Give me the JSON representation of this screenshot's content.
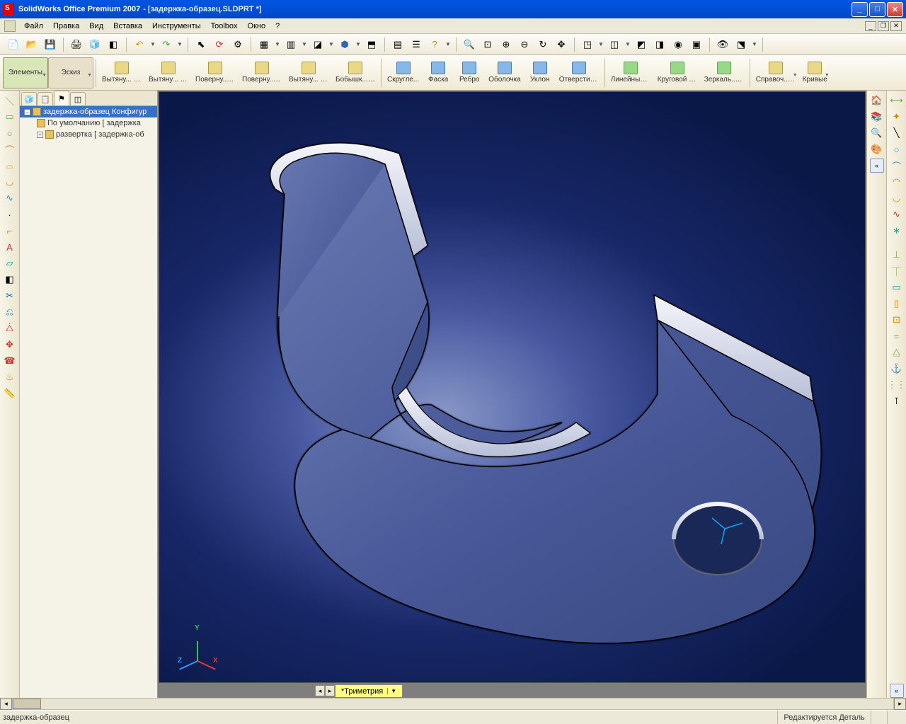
{
  "app": {
    "title": "SolidWorks Office Premium 2007",
    "doc": "- [задержка-образец.SLDPRT *]"
  },
  "menu": {
    "file": "Файл",
    "edit": "Правка",
    "view": "Вид",
    "insert": "Вставка",
    "tools": "Инструменты",
    "toolbox": "Toolbox",
    "window": "Окно",
    "help": "?"
  },
  "cmdBar": {
    "elements": "Элементы",
    "sketch": "Эскиз",
    "extrudeBoss": "Вытяну...\nбобышк...",
    "extrudeCut": "Вытяну...\nвырез",
    "revBoss": "Поверну...\nбобышк...",
    "revCut": "Поверну...\nвырез",
    "sweepBoss": "Вытяну...\nбобышк...",
    "loft": "Бобышк...\nпо сече...",
    "fillet": "Скругле...",
    "chamfer": "Фаска",
    "rib": "Ребро",
    "shell": "Оболочка",
    "draft": "Уклон",
    "hole": "Отверстие\nпод кре...",
    "linPattern": "Линейный\nмассив",
    "circPattern": "Круговой\nмассив",
    "mirror": "Зеркаль...\nотраже...",
    "refGeom": "Справоч...\nгеометрия",
    "curves": "Кривые"
  },
  "tree": {
    "root": "задержка-образец Конфигур",
    "defaultCfg": "По умолчанию [ задержка",
    "flatCfg": "развертка [ задержка-об"
  },
  "viewTab": "*Триметрия",
  "status": {
    "left": "задержка-образец",
    "right": "Редактируется Деталь"
  }
}
